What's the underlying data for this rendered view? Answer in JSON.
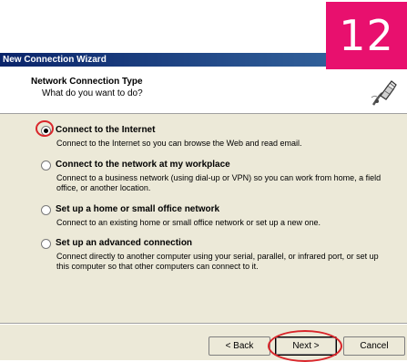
{
  "step_badge": "12",
  "window": {
    "title": "New Connection Wizard",
    "header_title": "Network Connection Type",
    "header_subtitle": "What do you want to do?",
    "header_icon": "network-cable-icon"
  },
  "options": [
    {
      "label": "Connect to the Internet",
      "description": "Connect to the Internet so you can browse the Web and read email.",
      "selected": true
    },
    {
      "label": "Connect to the network at my workplace",
      "description": "Connect to a business network (using dial-up or VPN) so you can work from home, a field office, or another location.",
      "selected": false
    },
    {
      "label": "Set up a home or small office network",
      "description": "Connect to an existing home or small office network or set up a new one.",
      "selected": false
    },
    {
      "label": "Set up an advanced connection",
      "description": "Connect directly to another computer using your serial, parallel, or infrared port, or set up this computer so that other computers can connect to it.",
      "selected": false
    }
  ],
  "buttons": {
    "back": "< Back",
    "next": "Next >",
    "cancel": "Cancel"
  },
  "colors": {
    "badge": "#e8106e",
    "highlight": "#d9262b",
    "titlebar": "#0a246a"
  }
}
